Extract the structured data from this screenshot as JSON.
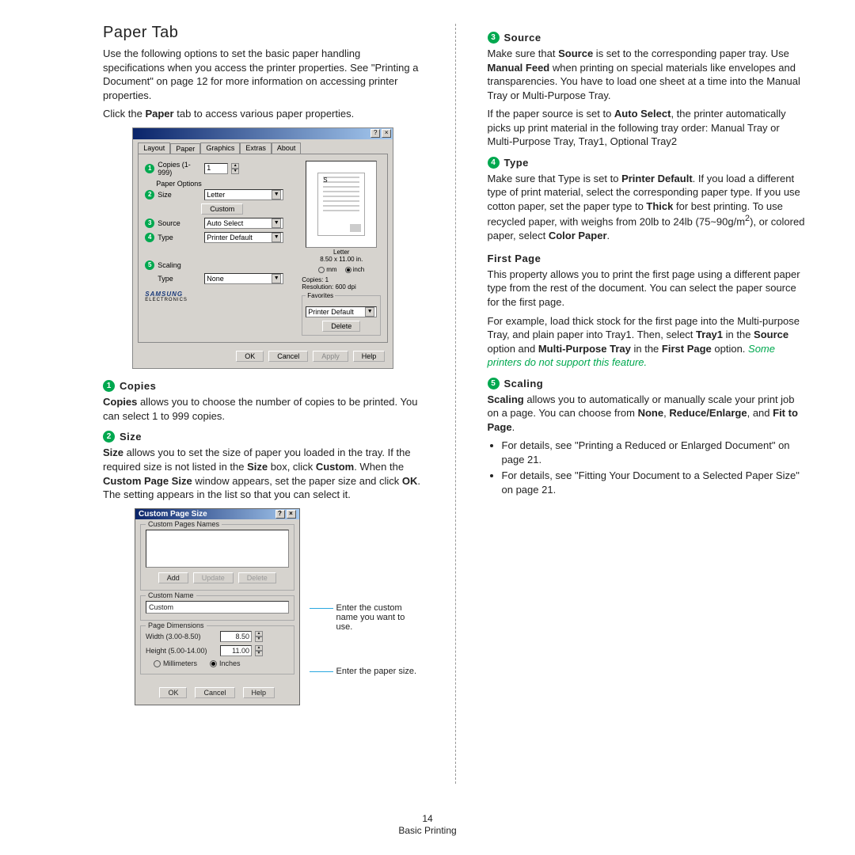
{
  "pageTitle": "Paper Tab",
  "intro1": "Use the following options to set the basic paper handling specifications when you access the printer properties. See \"Printing a Document\" on page 12 for more information on accessing printer properties.",
  "intro2": "Click the Paper tab to access various paper properties.",
  "dlg1": {
    "tabs": [
      "Layout",
      "Paper",
      "Graphics",
      "Extras",
      "About"
    ],
    "activeTab": 1,
    "copiesLabel": "Copies (1-999)",
    "copiesVal": "1",
    "paperOptions": "Paper Options",
    "sizeLabel": "Size",
    "sizeVal": "Letter",
    "customBtn": "Custom",
    "sourceLabel": "Source",
    "sourceVal": "Auto Select",
    "typeLabel": "Type",
    "typeVal": "Printer Default",
    "scalingLabel": "Scaling",
    "scalingTypeLabel": "Type",
    "scalingTypeVal": "None",
    "previewName": "Letter",
    "previewDim": "8.50 x 11.00 in.",
    "unit_mm": "mm",
    "unit_inch": "inch",
    "infoCopies": "Copies: 1",
    "infoRes": "Resolution: 600 dpi",
    "favTitle": "Favorites",
    "favVal": "Printer Default",
    "favDel": "Delete",
    "logo": "SAMSUNG",
    "logoSub": "ELECTRONICS",
    "btnOK": "OK",
    "btnCancel": "Cancel",
    "btnApply": "Apply",
    "btnHelp": "Help"
  },
  "s1": {
    "title": "Copies",
    "body": "Copies allows you to choose the number of copies to be printed. You can select 1 to 999 copies."
  },
  "s2": {
    "title": "Size",
    "body": "Size allows you to set the size of paper you loaded in the tray. If the required size is not listed in the Size box, click Custom. When the Custom Page Size window appears, set the paper size and click OK. The setting appears in the list so that you can select it."
  },
  "dlg2": {
    "title": "Custom Page Size",
    "grpNames": "Custom Pages Names",
    "btnAdd": "Add",
    "btnUpdate": "Update",
    "btnDelete": "Delete",
    "grpCustomName": "Custom Name",
    "nameVal": "Custom",
    "grpDim": "Page Dimensions",
    "widthLabel": "Width (3.00-8.50)",
    "widthVal": "8.50",
    "heightLabel": "Height (5.00-14.00)",
    "heightVal": "11.00",
    "unitMM": "Millimeters",
    "unitIN": "Inches",
    "btnOK": "OK",
    "btnCancel": "Cancel",
    "btnHelp": "Help"
  },
  "callouts": {
    "name": "Enter the custom name you want to use.",
    "size": "Enter the paper size."
  },
  "s3": {
    "title": "Source",
    "p1": "Make sure that Source is set to the corresponding paper tray. Use Manual Feed when printing on special materials like envelopes and transparencies. You have to load one sheet at a time into the Manual Tray or Multi-Purpose Tray.",
    "p2": "If the paper source is set to Auto Select, the printer automatically picks up print material in the following tray order: Manual Tray or Multi-Purpose Tray, Tray1, Optional Tray2"
  },
  "s4": {
    "title": "Type",
    "p1a": "Make sure that Type is set to ",
    "p1b": "Printer Default",
    "p1c": ". If you load a different type of print material, select the corresponding paper type. If you use cotton paper, set the paper type to ",
    "p1d": "Thick",
    "p1e": " for best printing. To use recycled paper, with weighs from 20lb to 24lb (75~90g/m",
    "p1f": "), or colored paper, select ",
    "p1g": "Color Paper",
    "p1h": "."
  },
  "fp": {
    "title": "First Page",
    "p1": "This property allows you to print the first page using a different paper type from the rest of the document. You can select the paper source for the first page.",
    "p2a": "For example, load thick stock for the first page into the Multi-purpose Tray, and plain paper into Tray1. Then, select ",
    "p2b": "Tray1",
    "p2c": " in the ",
    "p2d": "Source",
    "p2e": " option and ",
    "p2f": "Multi-Purpose Tray",
    "p2g": " in the ",
    "p2h": "First Page",
    "p2i": " option. ",
    "note": "Some printers do not support this feature."
  },
  "s5": {
    "title": "Scaling",
    "p1a": "Scaling",
    "p1b": " allows you to automatically or manually scale your print job on a page. You can choose from ",
    "p1c": "None",
    "p1d": ", ",
    "p1e": "Reduce/Enlarge",
    "p1f": ", and ",
    "p1g": "Fit to Page",
    "p1h": ".",
    "li1": "For details, see \"Printing a Reduced or Enlarged Document\" on page 21.",
    "li2": "For details, see \"Fitting Your Document to a Selected Paper Size\" on page 21."
  },
  "footer": {
    "num": "14",
    "chap": "Basic Printing"
  }
}
